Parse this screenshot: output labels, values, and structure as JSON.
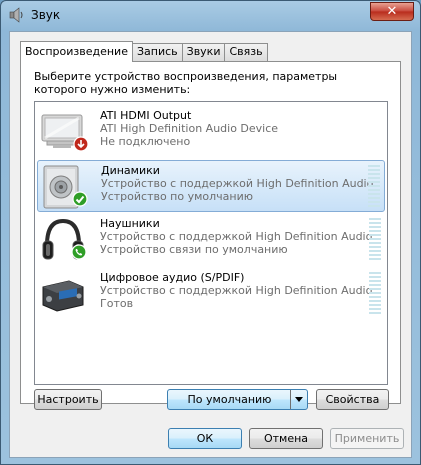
{
  "window": {
    "title": "Звук",
    "close_label": "✕"
  },
  "tabs": [
    {
      "label": "Воспроизведение",
      "active": true
    },
    {
      "label": "Запись",
      "active": false
    },
    {
      "label": "Звуки",
      "active": false
    },
    {
      "label": "Связь",
      "active": false
    }
  ],
  "instruction": "Выберите устройство воспроизведения, параметры которого нужно изменить:",
  "devices": [
    {
      "name": "ATI HDMI Output",
      "description": "ATI High Definition Audio Device",
      "status": "Не подключено",
      "icon": "monitor-icon",
      "badge": "disconnected",
      "selected": false
    },
    {
      "name": "Динамики",
      "description": "Устройство с поддержкой High Definition Audio",
      "status": "Устройство по умолчанию",
      "icon": "speaker-icon",
      "badge": "default-check",
      "selected": true
    },
    {
      "name": "Наушники",
      "description": "Устройство с поддержкой High Definition Audio",
      "status": "Устройство связи по умолчанию",
      "icon": "headphones-icon",
      "badge": "communication-phone",
      "selected": false
    },
    {
      "name": "Цифровое аудио (S/PDIF)",
      "description": "Устройство с поддержкой High Definition Audio",
      "status": "Готов",
      "icon": "spdif-receiver-icon",
      "badge": "none",
      "selected": false
    }
  ],
  "buttons": {
    "configure": "Настроить",
    "set_default": "По умолчанию",
    "properties": "Свойства",
    "ok": "ОК",
    "cancel": "Отмена",
    "apply": "Применить"
  },
  "colors": {
    "check_green": "#2f9e27",
    "disconnected_red": "#c0281c",
    "selection": "#c7e0f7"
  }
}
